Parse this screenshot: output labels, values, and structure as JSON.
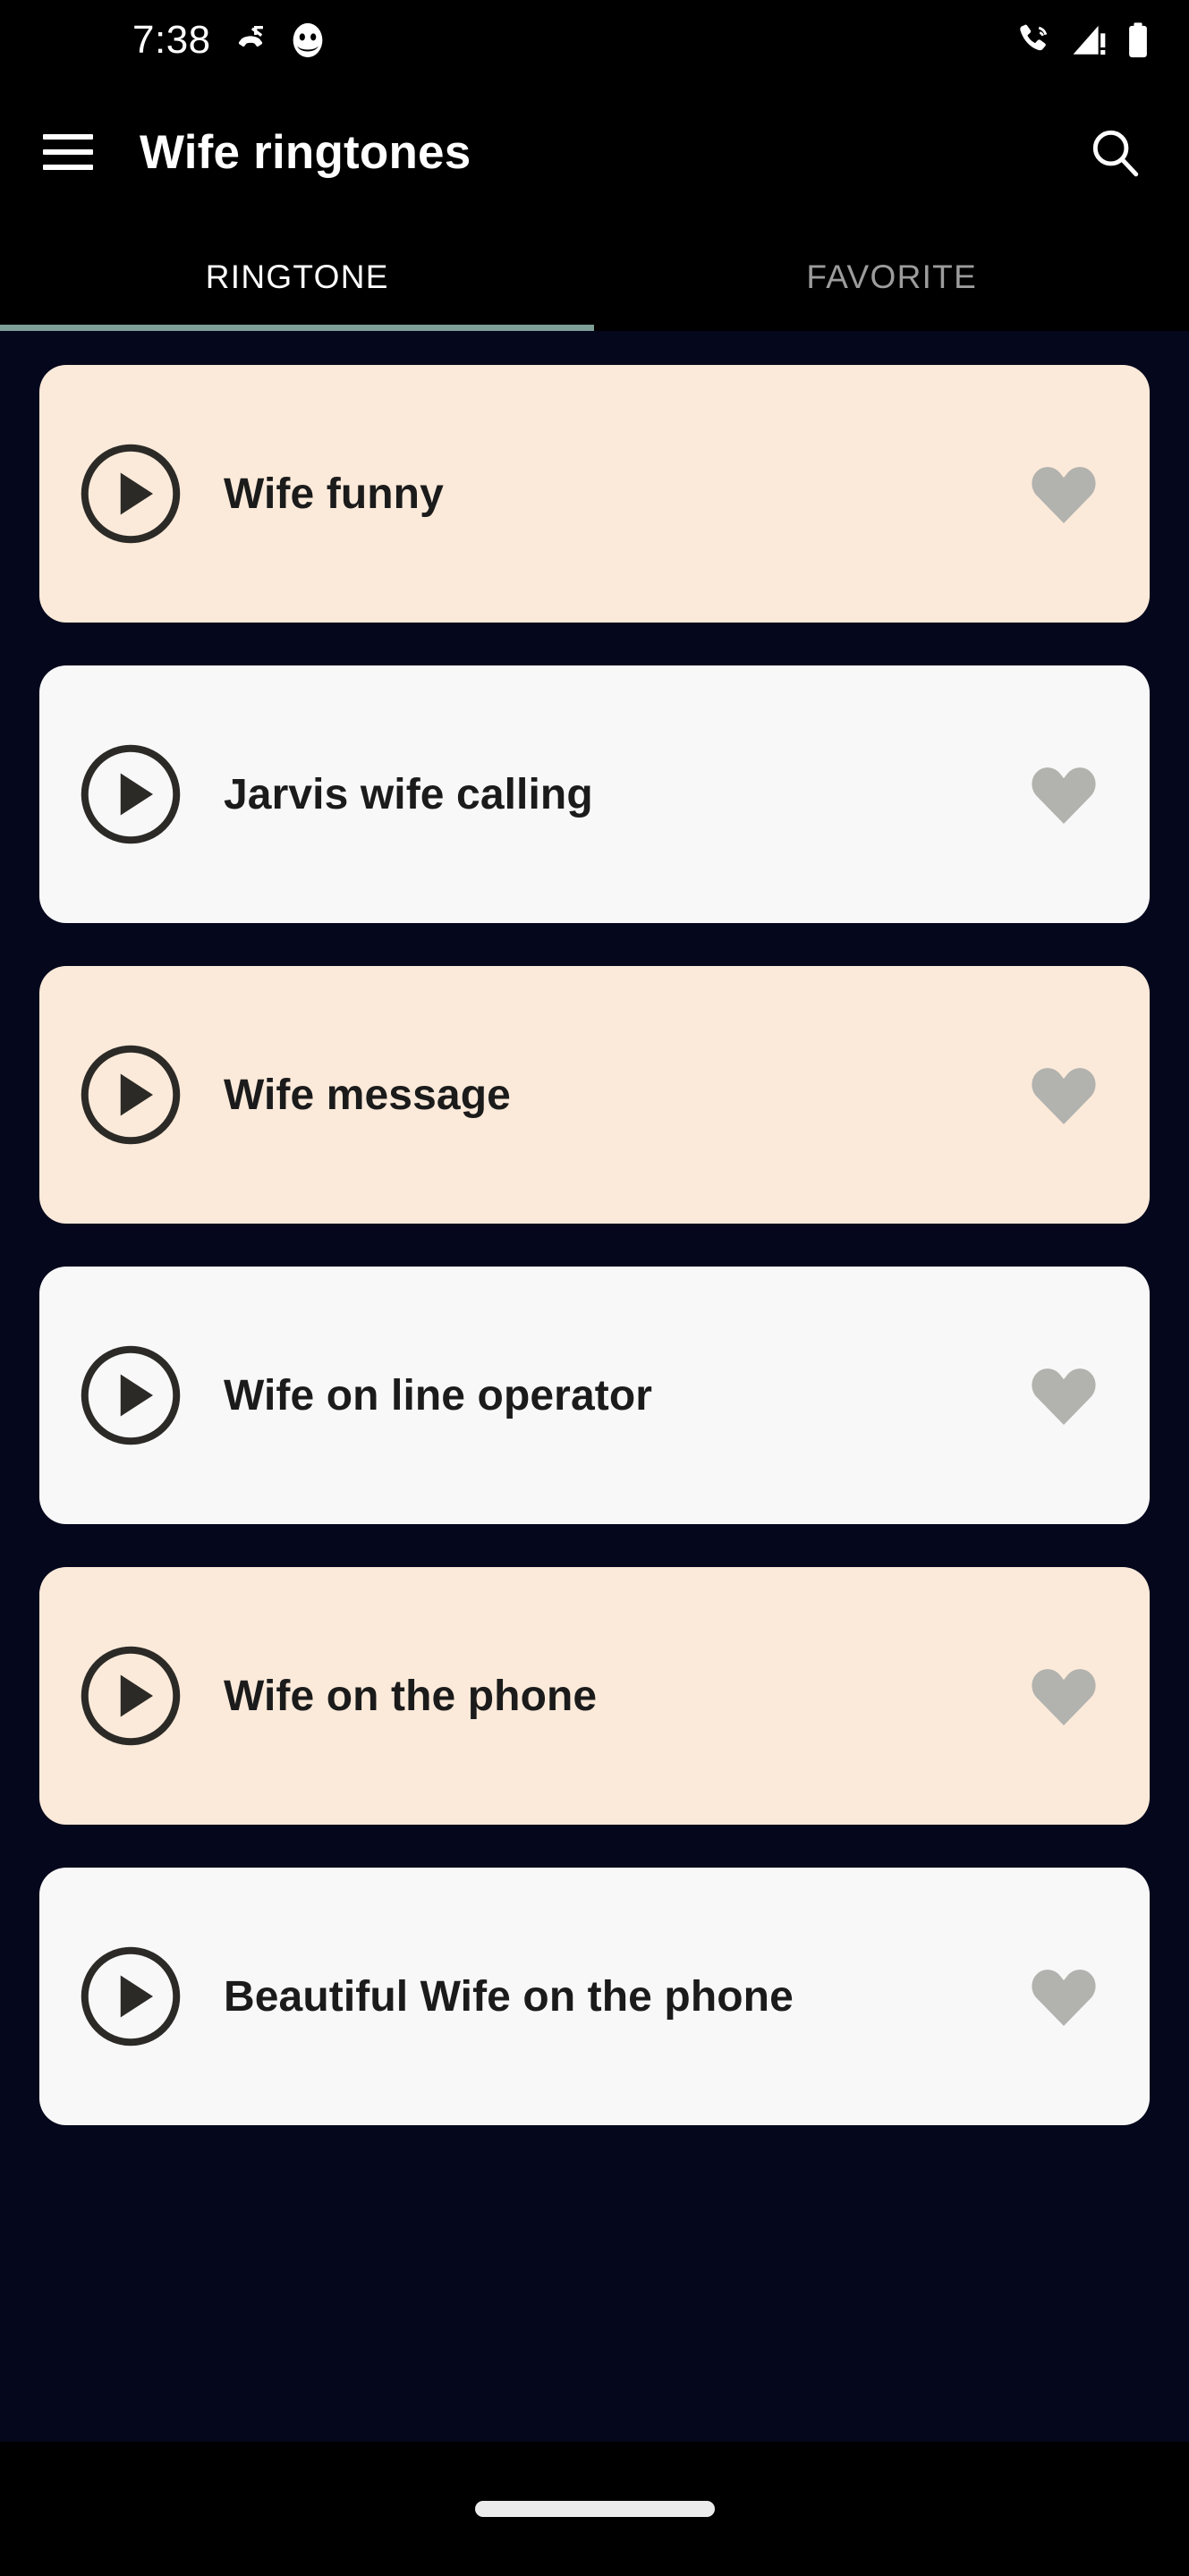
{
  "status_bar": {
    "time": "7:38",
    "left_icons": [
      {
        "name": "missed-call-icon"
      },
      {
        "name": "app-notification-icon"
      }
    ],
    "right_icons": [
      {
        "name": "call-ring-icon"
      },
      {
        "name": "cellular-signal-warning-icon"
      },
      {
        "name": "battery-full-icon"
      }
    ]
  },
  "app_bar": {
    "menu_icon": "hamburger-menu-icon",
    "title": "Wife ringtones",
    "search_icon": "search-icon"
  },
  "tabs": {
    "items": [
      {
        "label": "RINGTONE",
        "active": true
      },
      {
        "label": "FAVORITE",
        "active": false
      }
    ],
    "indicator_color": "#7d9f96"
  },
  "ringtones": [
    {
      "title": "Wife funny",
      "variant": "cream",
      "play_icon": "play-circle-icon",
      "favorite_icon": "heart-icon",
      "favorited": false
    },
    {
      "title": "Jarvis wife calling",
      "variant": "white",
      "play_icon": "play-circle-icon",
      "favorite_icon": "heart-icon",
      "favorited": false
    },
    {
      "title": "Wife message",
      "variant": "cream",
      "play_icon": "play-circle-icon",
      "favorite_icon": "heart-icon",
      "favorited": false
    },
    {
      "title": "Wife on line operator",
      "variant": "white",
      "play_icon": "play-circle-icon",
      "favorite_icon": "heart-icon",
      "favorited": false
    },
    {
      "title": "Wife on the phone",
      "variant": "cream",
      "play_icon": "play-circle-icon",
      "favorite_icon": "heart-icon",
      "favorited": false
    },
    {
      "title": "Beautiful Wife on the phone",
      "variant": "white",
      "play_icon": "play-circle-icon",
      "favorite_icon": "heart-icon",
      "favorited": false
    }
  ],
  "nav_bar": {
    "gesture_handle": "home-gesture-pill"
  },
  "colors": {
    "background": "#05071c",
    "card_cream": "#fbeada",
    "card_white": "#f8f8f9",
    "accent": "#7d9f96",
    "heart_inactive": "#b2b2ae",
    "text_dark": "#1b1b1b",
    "tab_inactive": "#9c9c9c"
  }
}
